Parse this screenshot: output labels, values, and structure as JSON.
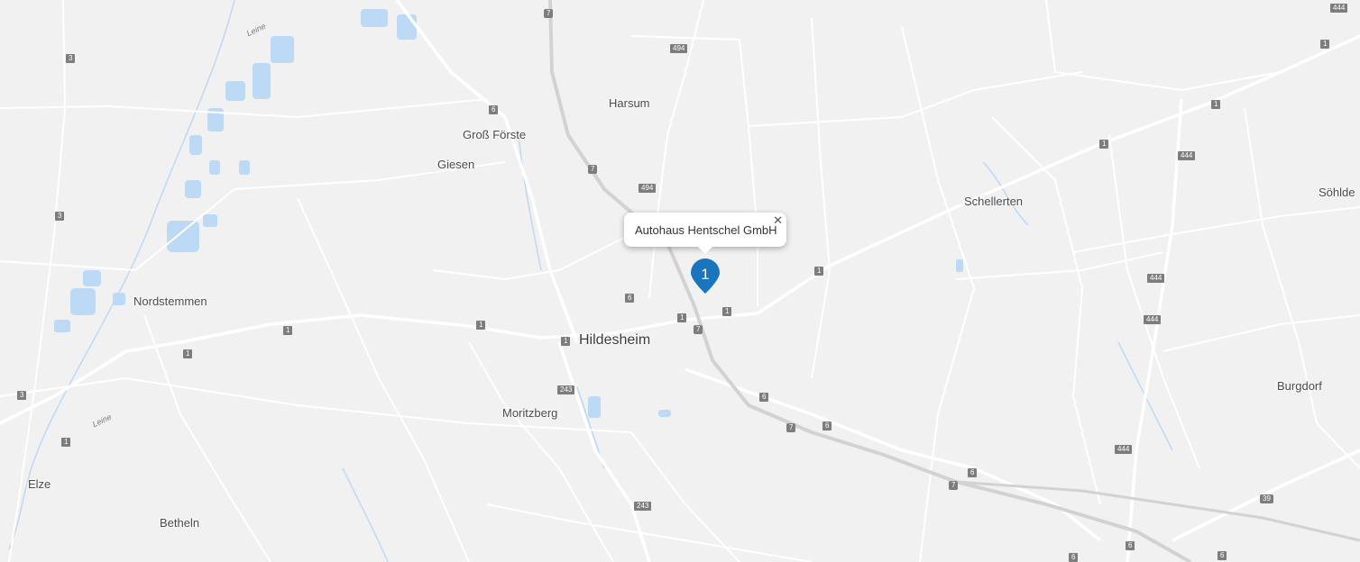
{
  "popup": {
    "title": "Autohaus Hentschel GmbH",
    "close_icon": "close-icon"
  },
  "marker": {
    "label": "1",
    "color": "#1a75bc"
  },
  "places": {
    "hildesheim": "Hildesheim",
    "harsum": "Harsum",
    "gross_foerste": "Groß Förste",
    "giesen": "Giesen",
    "schellerten": "Schellerten",
    "soehlde": "Söhlde",
    "nordstemmen": "Nordstemmen",
    "moritzberg": "Moritzberg",
    "burgdorf": "Burgdorf",
    "elze": "Elze",
    "betheln": "Betheln"
  },
  "rivers": {
    "leine_top": "Leine",
    "leine_bottom": "Leine"
  },
  "roads": {
    "r7a": "7",
    "r7b": "7",
    "r7c": "7",
    "r7d": "7",
    "r7e": "7",
    "r494a": "494",
    "r494b": "494",
    "r6a": "6",
    "r6b": "6",
    "r6c": "6",
    "r6d": "6",
    "r6e": "6",
    "r6f": "6",
    "r6g": "6",
    "r6h": "6",
    "r1a": "1",
    "r1b": "1",
    "r1c": "1",
    "r1d": "1",
    "r1e": "1",
    "r1f": "1",
    "r1g": "1",
    "r1h": "1",
    "r1i": "1",
    "r1j": "1",
    "r1k": "1",
    "r3a": "3",
    "r3b": "3",
    "r3c": "3",
    "r243a": "243",
    "r243b": "243",
    "r444a": "444",
    "r444b": "444",
    "r444c": "444",
    "r444d": "444",
    "r444e": "444",
    "r39": "39"
  },
  "colors": {
    "background": "#f1f1f1",
    "road": "#ffffff",
    "motorway": "#d0d0d0",
    "water": "#bcd9f5",
    "shield": "#7d7d7d"
  }
}
